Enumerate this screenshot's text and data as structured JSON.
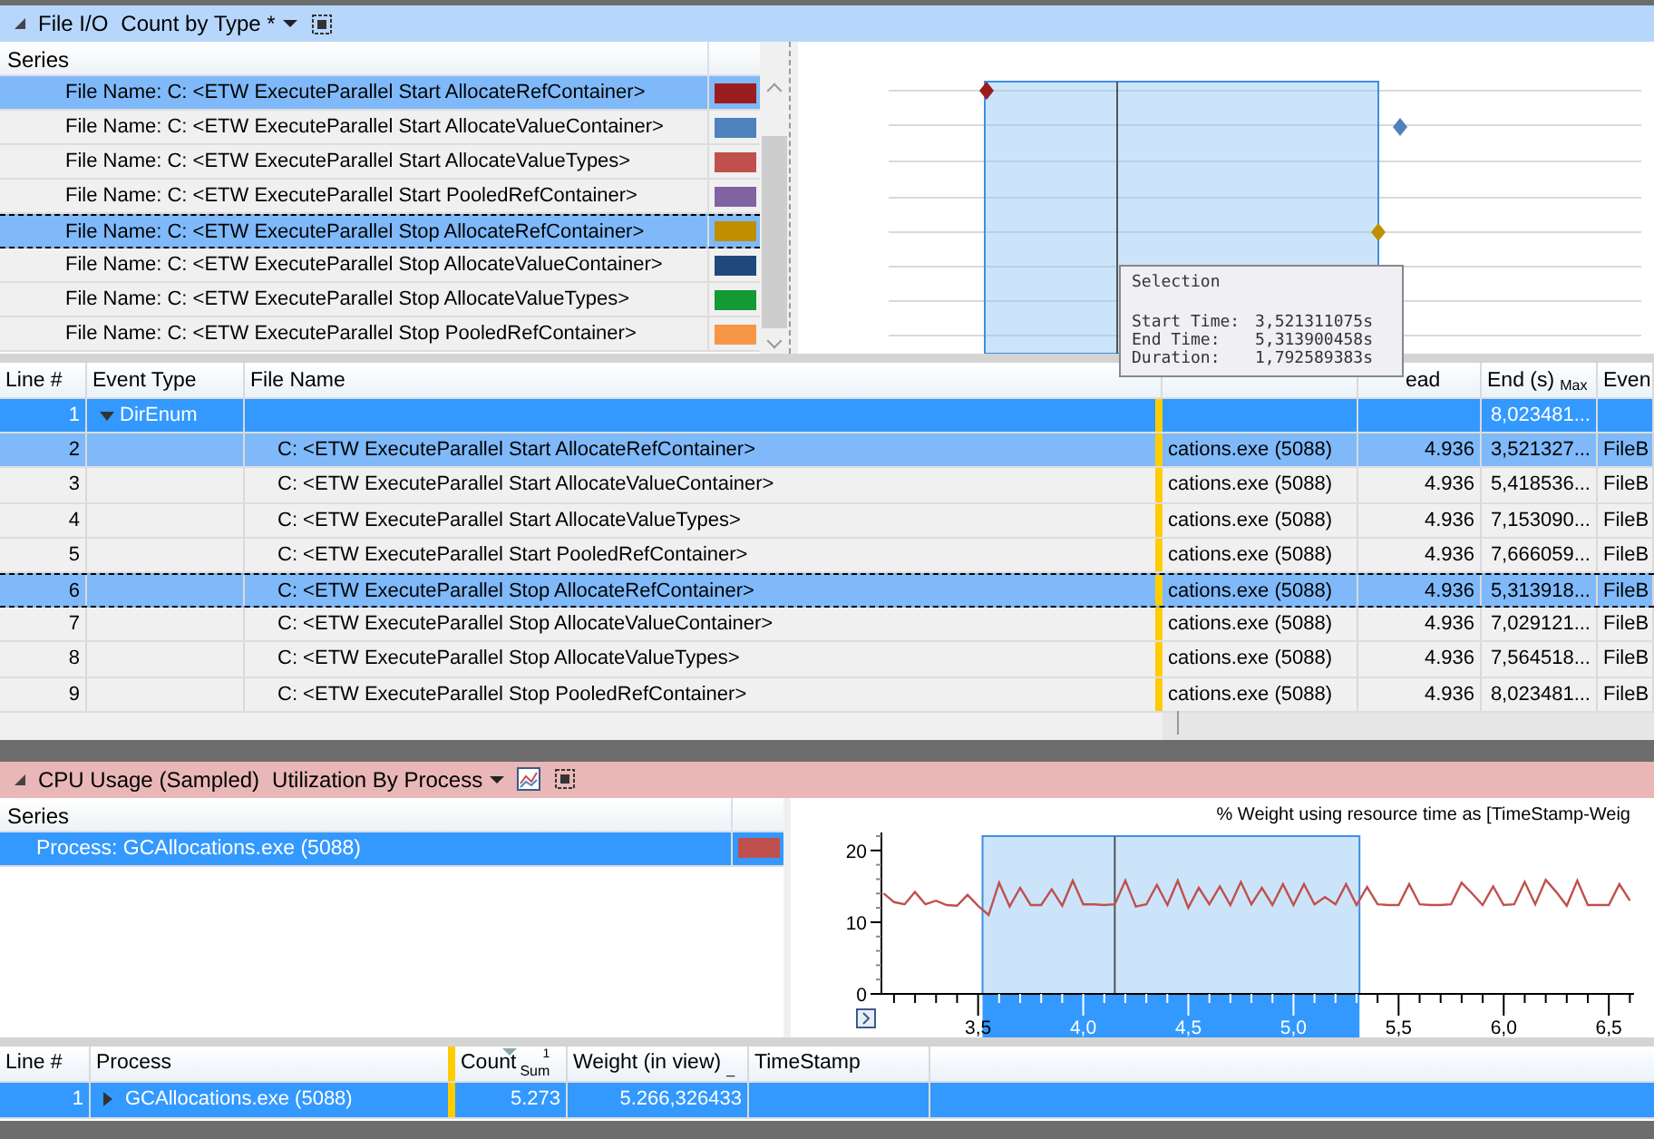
{
  "file_io": {
    "title": "File I/O",
    "preset": "Count by Type *",
    "series_header": "Series",
    "series": [
      {
        "label": "File Name: C: <ETW ExecuteParallel Start AllocateRefContainer>",
        "color": "#9b1c1f",
        "selected": true,
        "focused": false
      },
      {
        "label": "File Name: C: <ETW ExecuteParallel Start AllocateValueContainer>",
        "color": "#4f81bd",
        "selected": false,
        "focused": false
      },
      {
        "label": "File Name: C: <ETW ExecuteParallel Start AllocateValueTypes>",
        "color": "#c0504d",
        "selected": false,
        "focused": false
      },
      {
        "label": "File Name: C: <ETW ExecuteParallel Start PooledRefContainer>",
        "color": "#8064a2",
        "selected": false,
        "focused": false
      },
      {
        "label": "File Name: C: <ETW ExecuteParallel Stop AllocateRefContainer>",
        "color": "#bf8f00",
        "selected": true,
        "focused": true
      },
      {
        "label": "File Name: C: <ETW ExecuteParallel Stop AllocateValueContainer>",
        "color": "#1f497d",
        "selected": false,
        "focused": false
      },
      {
        "label": "File Name: C: <ETW ExecuteParallel Stop AllocateValueTypes>",
        "color": "#139a35",
        "selected": false,
        "focused": false
      },
      {
        "label": "File Name: C: <ETW ExecuteParallel Stop PooledRefContainer>",
        "color": "#f79646",
        "selected": false,
        "focused": false
      }
    ],
    "tooltip": {
      "title": "Selection",
      "rows": [
        {
          "label": "Start Time:",
          "value": "3,521311075s"
        },
        {
          "label": "End Time:",
          "value": "5,313900458s"
        },
        {
          "label": "Duration:",
          "value": "1,792589383s"
        }
      ]
    },
    "table": {
      "columns": [
        {
          "label": "Line #"
        },
        {
          "label": "Event Type"
        },
        {
          "label": "File Name"
        },
        {},
        {
          "label": "ead"
        },
        {
          "label": "End (s)",
          "sub": "Max"
        },
        {
          "label": "Even"
        }
      ],
      "rows": [
        {
          "kind": "group",
          "selected": true,
          "focused": false,
          "expanded": true,
          "line": "1",
          "event_type": "DirEnum",
          "file_name": "",
          "process": "",
          "count": "",
          "end": "8,023481...",
          "event": ""
        },
        {
          "kind": "item",
          "selected": true,
          "focused": false,
          "line": "2",
          "file_name": "C: <ETW ExecuteParallel Start AllocateRefContainer>",
          "process": "cations.exe (5088)",
          "count": "4.936",
          "end": "3,521327...",
          "event": "FileB"
        },
        {
          "kind": "item",
          "selected": false,
          "focused": false,
          "line": "3",
          "file_name": "C: <ETW ExecuteParallel Start AllocateValueContainer>",
          "process": "cations.exe (5088)",
          "count": "4.936",
          "end": "5,418536...",
          "event": "FileB"
        },
        {
          "kind": "item",
          "selected": false,
          "focused": false,
          "line": "4",
          "file_name": "C: <ETW ExecuteParallel Start AllocateValueTypes>",
          "process": "cations.exe (5088)",
          "count": "4.936",
          "end": "7,153090...",
          "event": "FileB"
        },
        {
          "kind": "item",
          "selected": false,
          "focused": false,
          "line": "5",
          "file_name": "C: <ETW ExecuteParallel Start PooledRefContainer>",
          "process": "cations.exe (5088)",
          "count": "4.936",
          "end": "7,666059...",
          "event": "FileB"
        },
        {
          "kind": "item",
          "selected": true,
          "focused": true,
          "line": "6",
          "file_name": "C: <ETW ExecuteParallel Stop AllocateRefContainer>",
          "process": "cations.exe (5088)",
          "count": "4.936",
          "end": "5,313918...",
          "event": "FileB"
        },
        {
          "kind": "item",
          "selected": false,
          "focused": false,
          "line": "7",
          "file_name": "C: <ETW ExecuteParallel Stop AllocateValueContainer>",
          "process": "cations.exe (5088)",
          "count": "4.936",
          "end": "7,029121...",
          "event": "FileB"
        },
        {
          "kind": "item",
          "selected": false,
          "focused": false,
          "line": "8",
          "file_name": "C: <ETW ExecuteParallel Stop AllocateValueTypes>",
          "process": "cations.exe (5088)",
          "count": "4.936",
          "end": "7,564518...",
          "event": "FileB"
        },
        {
          "kind": "item",
          "selected": false,
          "focused": false,
          "line": "9",
          "file_name": "C: <ETW ExecuteParallel Stop PooledRefContainer>",
          "process": "cations.exe (5088)",
          "count": "4.936",
          "end": "8,023481...",
          "event": "FileB"
        }
      ]
    }
  },
  "cpu": {
    "title": "CPU Usage (Sampled)",
    "preset": "Utilization By Process",
    "series_header": "Series",
    "series": [
      {
        "label": "Process: GCAllocations.exe (5088)",
        "color": "#c0504d",
        "selected": true
      }
    ],
    "chart_data": {
      "type": "line",
      "title": "% Weight using resource time as [TimeStamp-Weig",
      "x": [
        3.05,
        3.1,
        3.15,
        3.2,
        3.25,
        3.3,
        3.35,
        3.4,
        3.45,
        3.5,
        3.55,
        3.6,
        3.65,
        3.7,
        3.75,
        3.8,
        3.85,
        3.9,
        3.95,
        4.0,
        4.05,
        4.1,
        4.15,
        4.2,
        4.25,
        4.3,
        4.35,
        4.4,
        4.45,
        4.5,
        4.55,
        4.6,
        4.65,
        4.7,
        4.75,
        4.8,
        4.85,
        4.9,
        4.95,
        5.0,
        5.05,
        5.1,
        5.15,
        5.2,
        5.25,
        5.3,
        5.35,
        5.4,
        5.45,
        5.5,
        5.55,
        5.6,
        5.65,
        5.7,
        5.75,
        5.8,
        5.85,
        5.9,
        5.95,
        6.0,
        6.05,
        6.1,
        6.15,
        6.2,
        6.25,
        6.3,
        6.35,
        6.4,
        6.45,
        6.5,
        6.55,
        6.6
      ],
      "series": [
        {
          "color": "#c0504d",
          "values": [
            14,
            12.8,
            12.5,
            14.2,
            12.5,
            13,
            12.4,
            12.3,
            13.8,
            12.3,
            11,
            15.5,
            12.2,
            14.8,
            12.4,
            12.4,
            14.6,
            12.3,
            15.8,
            12.5,
            12.5,
            12.4,
            12.5,
            15.8,
            12.2,
            12.5,
            15.2,
            12.4,
            15.8,
            12,
            14.8,
            12.5,
            15,
            12.4,
            15.6,
            12.5,
            14.8,
            12.4,
            15.3,
            12.4,
            15.3,
            12.5,
            13.5,
            12.5,
            15.3,
            12.4,
            14.9,
            12.5,
            12.4,
            12.4,
            15.3,
            12.5,
            12.4,
            12.4,
            12.5,
            15.5,
            14,
            12.4,
            15,
            12.4,
            12.5,
            15.6,
            12.5,
            15.9,
            14.2,
            12.3,
            15.8,
            12.4,
            12.4,
            12.4,
            15.3,
            13
          ]
        }
      ],
      "xlim": [
        3.04,
        6.62
      ],
      "ylim": [
        0,
        22
      ],
      "xticks": [
        {
          "value": 3.5,
          "label": "3,5"
        },
        {
          "value": 4.0,
          "label": "4,0"
        },
        {
          "value": 4.5,
          "label": "4,5"
        },
        {
          "value": 5.0,
          "label": "5,0"
        },
        {
          "value": 5.5,
          "label": "5,5"
        },
        {
          "value": 6.0,
          "label": "6,0"
        },
        {
          "value": 6.5,
          "label": "6,5"
        }
      ],
      "yticks": [
        0,
        10,
        20
      ],
      "bands": [
        {
          "axis": "x",
          "from": 3.521,
          "to": 5.314
        }
      ],
      "ref_lines": [
        {
          "axis": "x",
          "value": 4.15
        }
      ]
    },
    "table": {
      "columns": [
        {
          "label": "Line #"
        },
        {
          "label": "Process"
        },
        {
          "label": "Count",
          "sort_index": "1",
          "sub": "Sum"
        },
        {
          "label": "Weight (in view)",
          "sub": "_"
        },
        {
          "label": "TimeStamp"
        }
      ],
      "rows": [
        {
          "selected": true,
          "expanded": false,
          "line": "1",
          "process": "GCAllocations.exe (5088)",
          "count": "5.273",
          "weight": "5.266,326433"
        }
      ]
    }
  }
}
